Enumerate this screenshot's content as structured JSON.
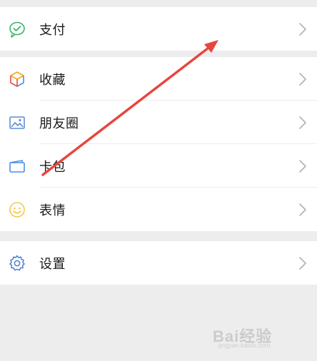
{
  "menu": {
    "pay": {
      "label": "支付",
      "icon": "pay-icon"
    },
    "favorites": {
      "label": "收藏",
      "icon": "favorites-cube-icon"
    },
    "moments": {
      "label": "朋友圈",
      "icon": "moments-image-icon"
    },
    "cards": {
      "label": "卡包",
      "icon": "card-wallet-icon"
    },
    "stickers": {
      "label": "表情",
      "icon": "smiley-icon"
    },
    "settings": {
      "label": "设置",
      "icon": "gear-icon"
    }
  },
  "watermark": {
    "text": "Bai经验",
    "sub": "jingyan.baidu.com"
  },
  "colors": {
    "background": "#ededed",
    "row_background": "#ffffff",
    "annotation_arrow": "#e8463f",
    "pay_green": "#3cb371",
    "favorites_orange": "#f5a623",
    "moments_blue": "#5b8fd4",
    "settings_blue": "#4a7fd4",
    "smiley_yellow": "#f2c94c"
  }
}
